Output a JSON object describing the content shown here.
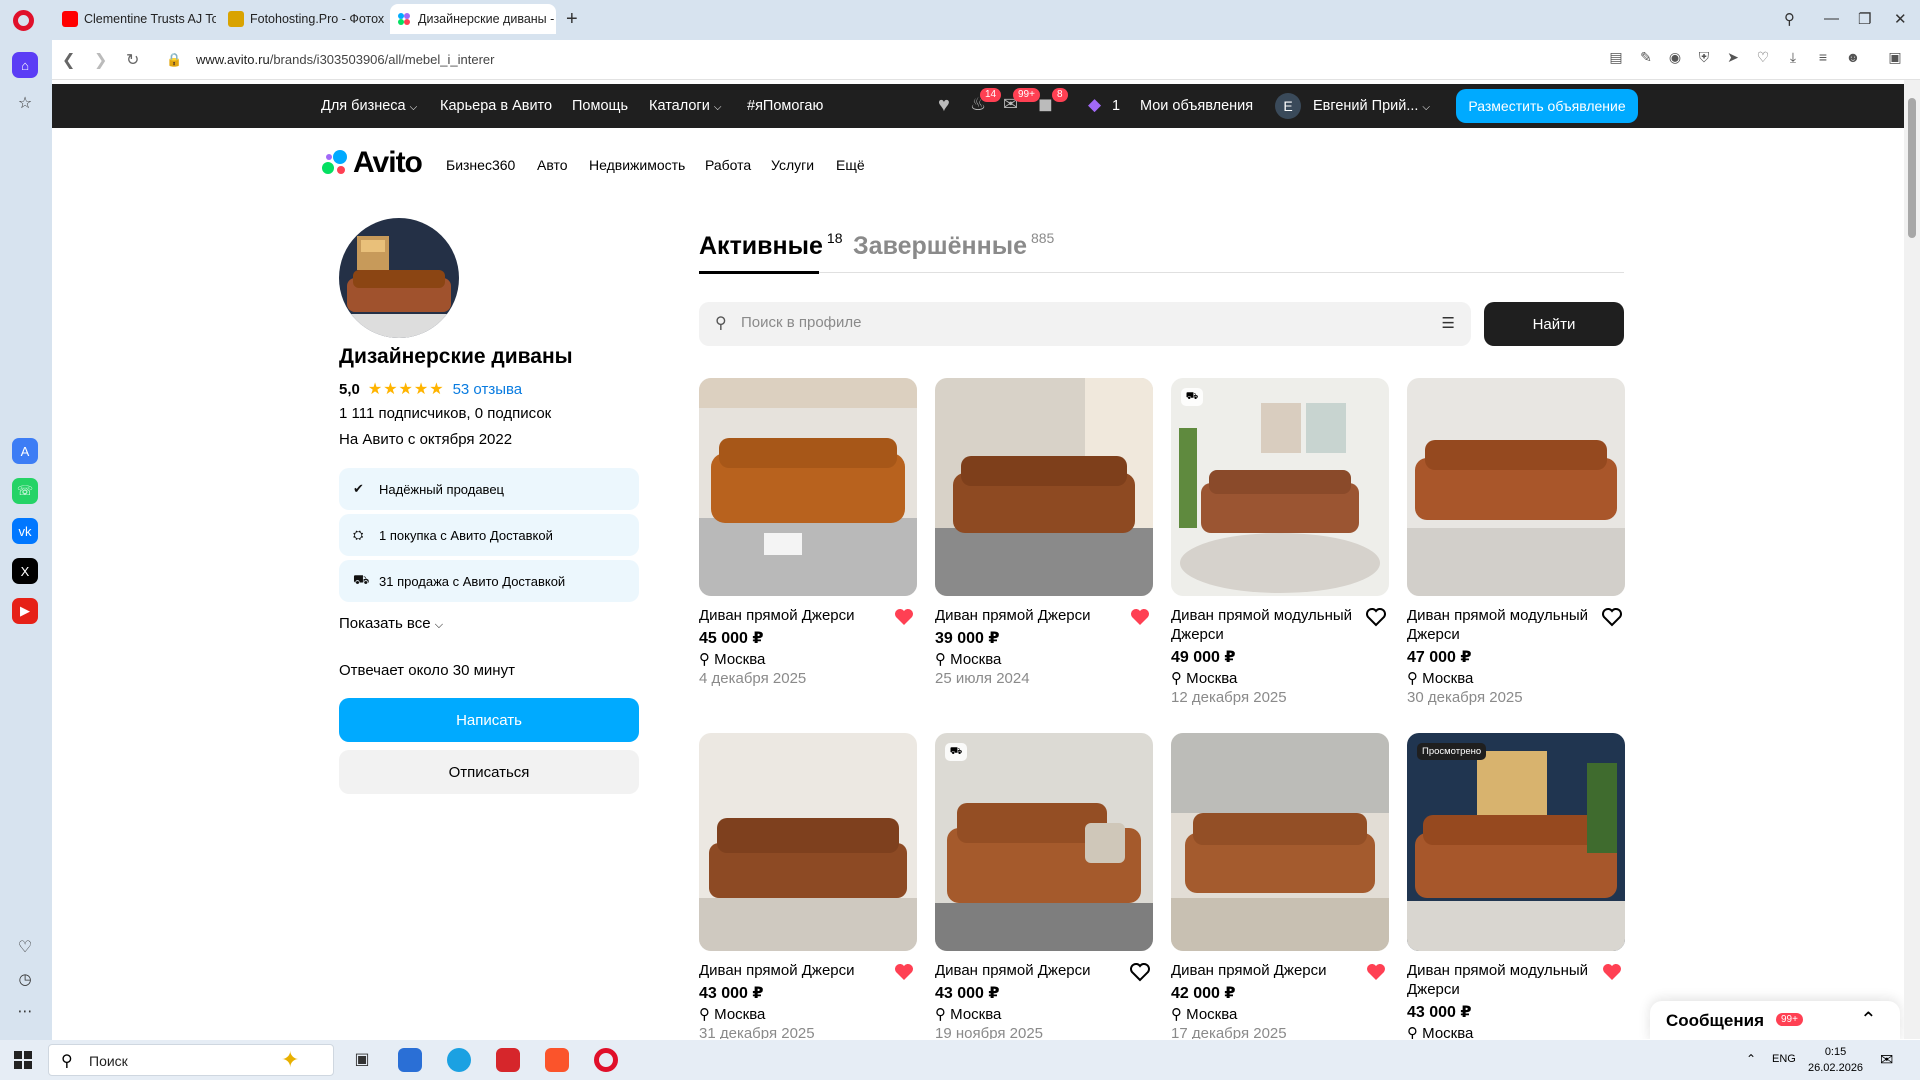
{
  "browser": {
    "tabs": [
      {
        "label": "Clementine Trusts AJ To M"
      },
      {
        "label": "Fotohosting.Pro - Фотохо"
      },
      {
        "label": "Дизайнерские диваны - ("
      }
    ],
    "url_host": "www.avito.ru",
    "url_path": "/brands/i303503906/all/mebel_i_interer"
  },
  "colors": {
    "accent": "#00aaff",
    "dark": "#1f1f1f",
    "fav": "#ff4053",
    "star": "#ffb400"
  },
  "avito_header": {
    "nav": [
      "Для бизнеса",
      "Карьера в Авито",
      "Помощь",
      "Каталоги",
      "#яПомогаю"
    ],
    "badges": {
      "notifications": "14",
      "messages": "99+",
      "cart": "8"
    },
    "promo_count": "1",
    "my_ads": "Мои объявления",
    "user_initial": "Е",
    "user_name": "Евгений Прий...",
    "post_ad": "Разместить объявление"
  },
  "logo": "Avito",
  "catnav": [
    "Бизнес360",
    "Авто",
    "Недвижимость",
    "Работа",
    "Услуги",
    "Ещё"
  ],
  "seller": {
    "name": "Дизайнерские диваны",
    "rating": "5,0",
    "reviews": "53 отзыва",
    "subscribers": "1 111 подписчиков, 0 подписок",
    "since": "На Авито с октября 2022",
    "chips": [
      "Надёжный продавец",
      "1 покупка с Авито Доставкой",
      "31 продажа с Авито Доставкой"
    ],
    "show_all": "Показать все",
    "reply_time": "Отвечает около 30 минут",
    "write": "Написать",
    "unsubscribe": "Отписаться"
  },
  "profile_tabs": {
    "active_label": "Активные",
    "active_count": "18",
    "done_label": "Завершённые",
    "done_count": "885"
  },
  "search": {
    "placeholder": "Поиск в профиле",
    "button": "Найти"
  },
  "listings": [
    {
      "title": "Диван прямой Джерси",
      "price": "45 000 ₽",
      "city": "Москва",
      "date": "4 декабря 2025",
      "fav": true
    },
    {
      "title": "Диван прямой Джерси",
      "price": "39 000 ₽",
      "city": "Москва",
      "date": "25 июля 2024",
      "fav": true
    },
    {
      "title": "Диван прямой модульный Джерси",
      "price": "49 000 ₽",
      "city": "Москва",
      "date": "12 декабря 2025",
      "fav": false
    },
    {
      "title": "Диван прямой модульный Джерси",
      "price": "47 000 ₽",
      "city": "Москва",
      "date": "30 декабря 2025",
      "fav": false
    },
    {
      "title": "Диван прямой Джерси",
      "price": "43 000 ₽",
      "city": "Москва",
      "date": "31 декабря 2025",
      "fav": true
    },
    {
      "title": "Диван прямой Джерси",
      "price": "43 000 ₽",
      "city": "Москва",
      "date": "19 ноября 2025",
      "fav": false
    },
    {
      "title": "Диван прямой Джерси",
      "price": "42 000 ₽",
      "city": "Москва",
      "date": "17 декабря 2025",
      "fav": true
    },
    {
      "title": "Диван прямой модульный Джерси",
      "price": "43 000 ₽",
      "city": "Москва",
      "date": "",
      "fav": true,
      "badge": "Просмотрено"
    }
  ],
  "messages_widget": {
    "label": "Сообщения",
    "badge": "99+"
  },
  "taskbar": {
    "search": "Поиск",
    "lang": "ENG",
    "time": "0:15",
    "date": "26.02.2026"
  }
}
